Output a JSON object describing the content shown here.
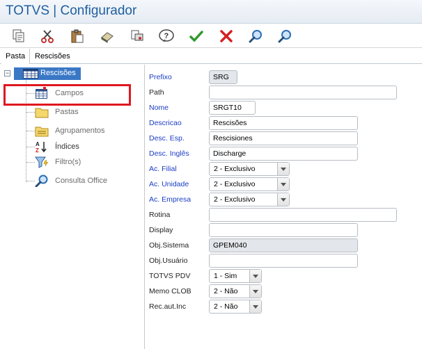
{
  "app": {
    "title": "TOTVS | Configurador"
  },
  "toolbar": {
    "buttons": [
      {
        "name": "copy-icon"
      },
      {
        "name": "cut-icon"
      },
      {
        "name": "paste-icon"
      },
      {
        "name": "eraser-icon"
      },
      {
        "name": "print-icon"
      },
      {
        "name": "help-icon"
      },
      {
        "name": "confirm-icon"
      },
      {
        "name": "cancel-icon"
      },
      {
        "name": "search-icon"
      },
      {
        "name": "search-next-icon"
      }
    ]
  },
  "tabs": [
    {
      "label": "Pasta"
    },
    {
      "label": "Rescisões"
    }
  ],
  "tree": {
    "root": {
      "label": "Rescisões",
      "toggle": "−"
    },
    "nodes": [
      {
        "label": "Campos",
        "icon": "table-icon"
      },
      {
        "label": "Pastas",
        "icon": "folder-icon"
      },
      {
        "label": "Agrupamentos",
        "icon": "folder-group-icon"
      },
      {
        "label": "Índices",
        "icon": "sort-az-icon"
      },
      {
        "label": "Filtro(s)",
        "icon": "filter-icon"
      },
      {
        "label": "Consulta Office",
        "icon": "magnifier-icon"
      }
    ]
  },
  "form": {
    "fields": [
      {
        "label": "Prefixo",
        "value": "SRG",
        "type": "gray",
        "blue": true
      },
      {
        "label": "Path",
        "value": "",
        "type": "text",
        "blue": false
      },
      {
        "label": "Nome",
        "value": "SRGT10",
        "type": "text",
        "blue": true
      },
      {
        "label": "Descricao",
        "value": "Rescisões",
        "type": "text",
        "blue": true
      },
      {
        "label": "Desc. Esp.",
        "value": "Rescisiones",
        "type": "text",
        "blue": true
      },
      {
        "label": "Desc. Inglês",
        "value": "Discharge",
        "type": "text",
        "blue": true
      },
      {
        "label": "Ac. Filial",
        "value": "2 - Exclusivo",
        "type": "select",
        "blue": true
      },
      {
        "label": "Ac. Unidade",
        "value": "2 - Exclusivo",
        "type": "select",
        "blue": true
      },
      {
        "label": "Ac. Empresa",
        "value": "2 - Exclusivo",
        "type": "select",
        "blue": true
      },
      {
        "label": "Rotina",
        "value": "",
        "type": "text",
        "blue": false
      },
      {
        "label": "Display",
        "value": "",
        "type": "text",
        "blue": false
      },
      {
        "label": "Obj.Sistema",
        "value": "GPEM040",
        "type": "gray",
        "blue": false
      },
      {
        "label": "Obj.Usuário",
        "value": "",
        "type": "text",
        "blue": false
      },
      {
        "label": "TOTVS PDV",
        "value": "1 - Sim",
        "type": "select",
        "blue": false
      },
      {
        "label": "Memo CLOB",
        "value": "2 - Não",
        "type": "select",
        "blue": false
      },
      {
        "label": "Rec.aut.Inc",
        "value": "2 - Não",
        "type": "select",
        "blue": false
      }
    ]
  },
  "colors": {
    "accent": "#3a78c6",
    "title": "#1f5fa0",
    "required_label": "#1a3cc4",
    "highlight": "#e0171f"
  }
}
